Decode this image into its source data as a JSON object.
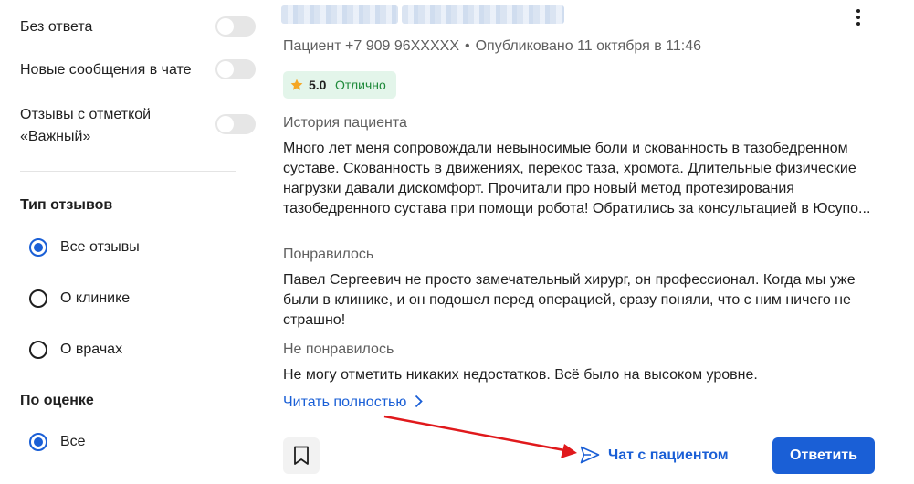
{
  "filters": {
    "toggles": [
      {
        "label": "Без ответа",
        "on": false
      },
      {
        "label": "Новые сообщения в чате",
        "on": false
      },
      {
        "label": "Отзывы с отметкой «Важный»",
        "on": false
      }
    ],
    "review_type": {
      "title": "Тип отзывов",
      "options": [
        {
          "label": "Все отзывы",
          "selected": true
        },
        {
          "label": "О клинике",
          "selected": false
        },
        {
          "label": "О врачах",
          "selected": false
        }
      ]
    },
    "by_rating": {
      "title": "По оценке",
      "options": [
        {
          "label": "Все",
          "selected": true
        }
      ]
    }
  },
  "review": {
    "author": "Пациент +7 909 96XXXXX",
    "published": "Опубликовано 11 октября в 11:46",
    "rating": {
      "score": "5.0",
      "label": "Отлично",
      "star_color": "#f5a623",
      "label_color": "#1f8a3b"
    },
    "sections": [
      {
        "label": "История пациента",
        "text": "Много лет меня сопровождали невыносимые боли и скованность в тазобедренном суставе. Скованность в движениях, перекос таза, хромота. Длительные физические нагрузки давали дискомфорт. Прочитали про новый метод протезирования тазобедренного сустава при помощи робота! Обратились за консультацией в Юсупо..."
      },
      {
        "label": "Понравилось",
        "text": "Павел Сергеевич не просто замечательный хирург, он профессионал. Когда мы уже были в клинике, и он подошел перед операцией, сразу поняли, что с ним ничего не страшно!"
      },
      {
        "label": "Не понравилось",
        "text": "Не могу отметить никаких недостатков. Всё было на высоком уровне."
      }
    ],
    "read_more": "Читать полностью",
    "actions": {
      "chat": "Чат с пациентом",
      "reply": "Ответить"
    }
  },
  "colors": {
    "accent": "#1a5fd6",
    "annotation_arrow": "#e0191c"
  },
  "icons": [
    "kebab-menu-icon",
    "star-icon",
    "chevron-right-icon",
    "bookmark-icon",
    "send-icon",
    "radio-selected-icon",
    "radio-unselected-icon"
  ]
}
